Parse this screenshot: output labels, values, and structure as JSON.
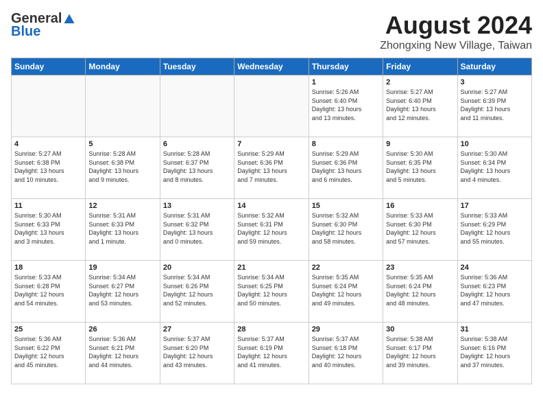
{
  "header": {
    "logo": {
      "general": "General",
      "blue": "Blue"
    },
    "title": "August 2024",
    "subtitle": "Zhongxing New Village, Taiwan"
  },
  "weekdays": [
    "Sunday",
    "Monday",
    "Tuesday",
    "Wednesday",
    "Thursday",
    "Friday",
    "Saturday"
  ],
  "weeks": [
    [
      {
        "num": "",
        "info": "",
        "empty": true
      },
      {
        "num": "",
        "info": "",
        "empty": true
      },
      {
        "num": "",
        "info": "",
        "empty": true
      },
      {
        "num": "",
        "info": "",
        "empty": true
      },
      {
        "num": "1",
        "info": "Sunrise: 5:26 AM\nSunset: 6:40 PM\nDaylight: 13 hours\nand 13 minutes."
      },
      {
        "num": "2",
        "info": "Sunrise: 5:27 AM\nSunset: 6:40 PM\nDaylight: 13 hours\nand 12 minutes."
      },
      {
        "num": "3",
        "info": "Sunrise: 5:27 AM\nSunset: 6:39 PM\nDaylight: 13 hours\nand 11 minutes."
      }
    ],
    [
      {
        "num": "4",
        "info": "Sunrise: 5:27 AM\nSunset: 6:38 PM\nDaylight: 13 hours\nand 10 minutes."
      },
      {
        "num": "5",
        "info": "Sunrise: 5:28 AM\nSunset: 6:38 PM\nDaylight: 13 hours\nand 9 minutes."
      },
      {
        "num": "6",
        "info": "Sunrise: 5:28 AM\nSunset: 6:37 PM\nDaylight: 13 hours\nand 8 minutes."
      },
      {
        "num": "7",
        "info": "Sunrise: 5:29 AM\nSunset: 6:36 PM\nDaylight: 13 hours\nand 7 minutes."
      },
      {
        "num": "8",
        "info": "Sunrise: 5:29 AM\nSunset: 6:36 PM\nDaylight: 13 hours\nand 6 minutes."
      },
      {
        "num": "9",
        "info": "Sunrise: 5:30 AM\nSunset: 6:35 PM\nDaylight: 13 hours\nand 5 minutes."
      },
      {
        "num": "10",
        "info": "Sunrise: 5:30 AM\nSunset: 6:34 PM\nDaylight: 13 hours\nand 4 minutes."
      }
    ],
    [
      {
        "num": "11",
        "info": "Sunrise: 5:30 AM\nSunset: 6:33 PM\nDaylight: 13 hours\nand 3 minutes."
      },
      {
        "num": "12",
        "info": "Sunrise: 5:31 AM\nSunset: 6:33 PM\nDaylight: 13 hours\nand 1 minute."
      },
      {
        "num": "13",
        "info": "Sunrise: 5:31 AM\nSunset: 6:32 PM\nDaylight: 13 hours\nand 0 minutes."
      },
      {
        "num": "14",
        "info": "Sunrise: 5:32 AM\nSunset: 6:31 PM\nDaylight: 12 hours\nand 59 minutes."
      },
      {
        "num": "15",
        "info": "Sunrise: 5:32 AM\nSunset: 6:30 PM\nDaylight: 12 hours\nand 58 minutes."
      },
      {
        "num": "16",
        "info": "Sunrise: 5:33 AM\nSunset: 6:30 PM\nDaylight: 12 hours\nand 57 minutes."
      },
      {
        "num": "17",
        "info": "Sunrise: 5:33 AM\nSunset: 6:29 PM\nDaylight: 12 hours\nand 55 minutes."
      }
    ],
    [
      {
        "num": "18",
        "info": "Sunrise: 5:33 AM\nSunset: 6:28 PM\nDaylight: 12 hours\nand 54 minutes."
      },
      {
        "num": "19",
        "info": "Sunrise: 5:34 AM\nSunset: 6:27 PM\nDaylight: 12 hours\nand 53 minutes."
      },
      {
        "num": "20",
        "info": "Sunrise: 5:34 AM\nSunset: 6:26 PM\nDaylight: 12 hours\nand 52 minutes."
      },
      {
        "num": "21",
        "info": "Sunrise: 5:34 AM\nSunset: 6:25 PM\nDaylight: 12 hours\nand 50 minutes."
      },
      {
        "num": "22",
        "info": "Sunrise: 5:35 AM\nSunset: 6:24 PM\nDaylight: 12 hours\nand 49 minutes."
      },
      {
        "num": "23",
        "info": "Sunrise: 5:35 AM\nSunset: 6:24 PM\nDaylight: 12 hours\nand 48 minutes."
      },
      {
        "num": "24",
        "info": "Sunrise: 5:36 AM\nSunset: 6:23 PM\nDaylight: 12 hours\nand 47 minutes."
      }
    ],
    [
      {
        "num": "25",
        "info": "Sunrise: 5:36 AM\nSunset: 6:22 PM\nDaylight: 12 hours\nand 45 minutes."
      },
      {
        "num": "26",
        "info": "Sunrise: 5:36 AM\nSunset: 6:21 PM\nDaylight: 12 hours\nand 44 minutes."
      },
      {
        "num": "27",
        "info": "Sunrise: 5:37 AM\nSunset: 6:20 PM\nDaylight: 12 hours\nand 43 minutes."
      },
      {
        "num": "28",
        "info": "Sunrise: 5:37 AM\nSunset: 6:19 PM\nDaylight: 12 hours\nand 41 minutes."
      },
      {
        "num": "29",
        "info": "Sunrise: 5:37 AM\nSunset: 6:18 PM\nDaylight: 12 hours\nand 40 minutes."
      },
      {
        "num": "30",
        "info": "Sunrise: 5:38 AM\nSunset: 6:17 PM\nDaylight: 12 hours\nand 39 minutes."
      },
      {
        "num": "31",
        "info": "Sunrise: 5:38 AM\nSunset: 6:16 PM\nDaylight: 12 hours\nand 37 minutes."
      }
    ]
  ]
}
